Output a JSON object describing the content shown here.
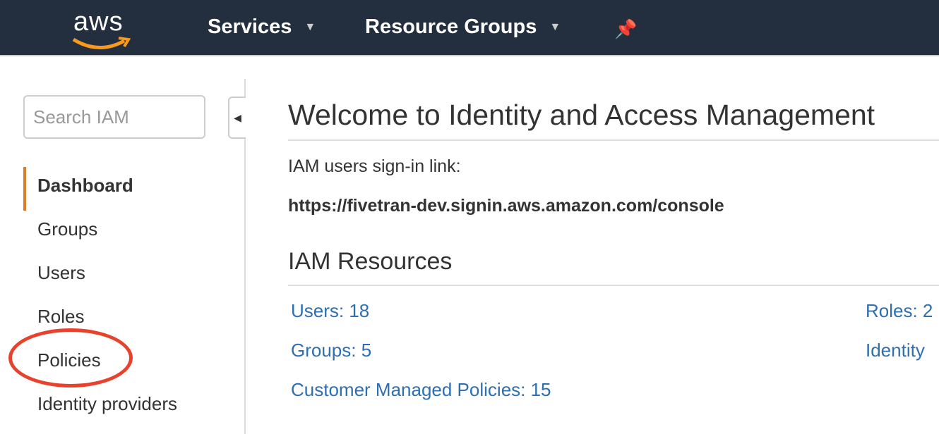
{
  "nav": {
    "logo": "aws",
    "services": "Services",
    "resource_groups": "Resource Groups",
    "colors": {
      "bg": "#232f3e",
      "logo_smile": "#f79a1e"
    }
  },
  "sidebar": {
    "search_placeholder": "Search IAM",
    "items": [
      {
        "label": "Dashboard",
        "active": true
      },
      {
        "label": "Groups"
      },
      {
        "label": "Users"
      },
      {
        "label": "Roles"
      },
      {
        "label": "Policies",
        "highlighted": true
      },
      {
        "label": "Identity providers"
      }
    ],
    "accent": "#e07b28"
  },
  "main": {
    "title": "Welcome to Identity and Access Management",
    "signin_label": "IAM users sign-in link:",
    "signin_url": "https://fivetran-dev.signin.aws.amazon.com/console",
    "resources_title": "IAM Resources",
    "resources": {
      "users": "Users: 18",
      "groups": "Groups: 5",
      "customer_policies": "Customer Managed Policies: 15",
      "roles": "Roles: 2",
      "identity": "Identity"
    }
  }
}
